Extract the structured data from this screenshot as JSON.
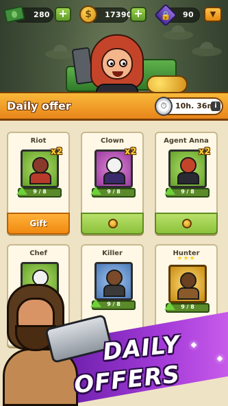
{
  "resources": {
    "cash": "280",
    "coins": "17390",
    "gems": "90"
  },
  "header": {
    "title": "Daily offer",
    "timer": "10h. 36m.",
    "info_label": "i"
  },
  "offers": [
    {
      "name": "Riot",
      "multiplier": "x2",
      "progress": "9 / 8",
      "footer": "Gift",
      "frame": "green"
    },
    {
      "name": "Clown",
      "multiplier": "x2",
      "progress": "9 / 8",
      "footer": "",
      "frame": "purple"
    },
    {
      "name": "Agent Anna",
      "multiplier": "x2",
      "progress": "9 / 8",
      "footer": "",
      "frame": "green"
    },
    {
      "name": "Chef",
      "multiplier": "",
      "progress": "",
      "footer": "",
      "frame": "green"
    },
    {
      "name": "Killer",
      "multiplier": "",
      "progress": "9 / 8",
      "footer": "",
      "frame": "blue"
    },
    {
      "name": "Hunter",
      "multiplier": "",
      "progress": "9 / 8",
      "footer": "",
      "frame": "gold",
      "stars": "★★★"
    }
  ],
  "promo": {
    "line1": "DAILY",
    "line2": "OFFERS"
  },
  "colors": {
    "banner": "#f0a02a",
    "panel": "#efe3c6",
    "promo_purple": "#8a2ed0",
    "gift_orange": "#f59a1f",
    "buy_green": "#9ccf4a"
  },
  "icons": {
    "cash": "cash-icon",
    "coin": "coin-icon",
    "gem": "gem-lock-icon",
    "timer": "stopwatch-icon",
    "upgrade": "up-arrow-icon"
  }
}
